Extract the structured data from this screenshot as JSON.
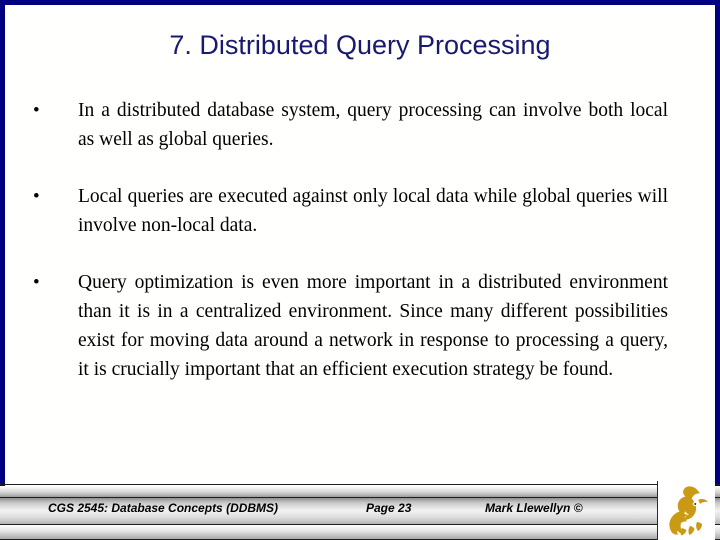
{
  "slide": {
    "title": "7. Distributed Query Processing",
    "title_color": "#191970",
    "background_color": "#fffffd",
    "frame_color": "#000080",
    "bullet_glyph": "•",
    "bullets": [
      "In a distributed database system, query processing can involve both local as well as global queries.",
      "Local queries are executed against only local data while global queries will involve non-local data.",
      "Query optimization is even more important in a distributed environment than it is in a centralized environment.  Since many different possibilities exist for moving data around a network in response to processing a query, it is crucially important that an efficient execution strategy be found."
    ]
  },
  "footer": {
    "course": "CGS 2545: Database Concepts  (DDBMS)",
    "page": "Page 23",
    "author": "Mark Llewellyn ©",
    "logo_name": "ucf-pegasus-logo",
    "logo_color": "#cb9a14"
  }
}
